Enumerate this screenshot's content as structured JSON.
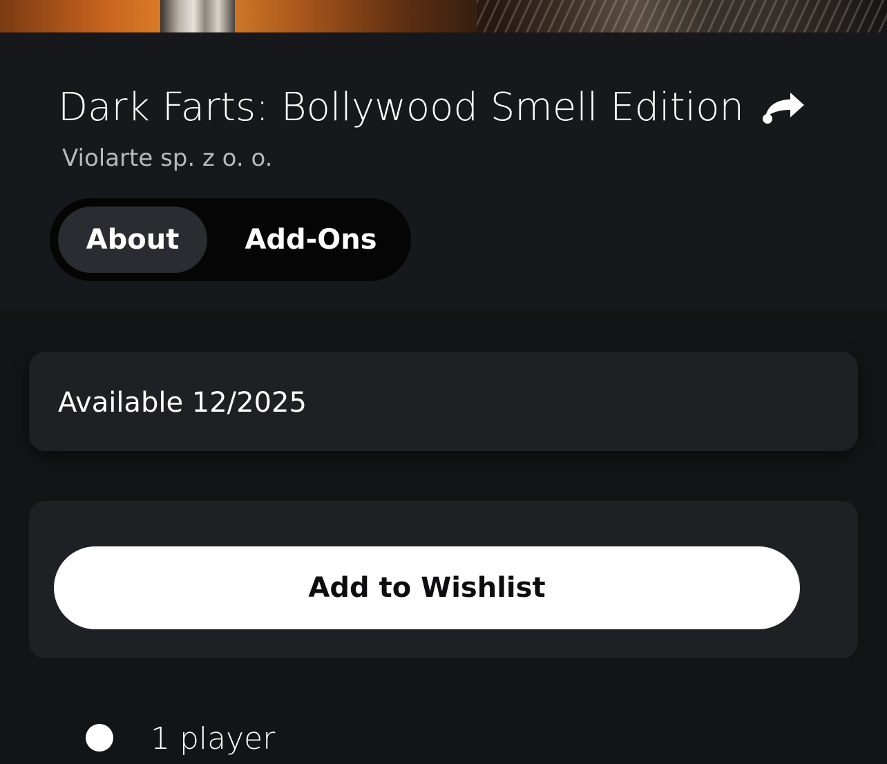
{
  "game": {
    "title": "Dark Farts: Bollywood Smell Edition",
    "publisher": "Violarte sp. z o. o.",
    "share_icon": "share-arrow-icon"
  },
  "tabs": {
    "items": [
      {
        "label": "About",
        "selected": true
      },
      {
        "label": "Add-Ons",
        "selected": false
      }
    ]
  },
  "release": {
    "availability": "Available 12/2025"
  },
  "actions": {
    "wishlist_label": "Add to Wishlist"
  },
  "features": {
    "items": [
      {
        "icon": "player-icon",
        "label": "1 player"
      }
    ]
  },
  "colors": {
    "page_bg": "#131416",
    "header_bg": "#17181b",
    "card_bg": "#1f2023",
    "tab_selected_bg": "#2b2c31",
    "tab_track_bg": "#050506",
    "button_bg": "#ffffff"
  }
}
